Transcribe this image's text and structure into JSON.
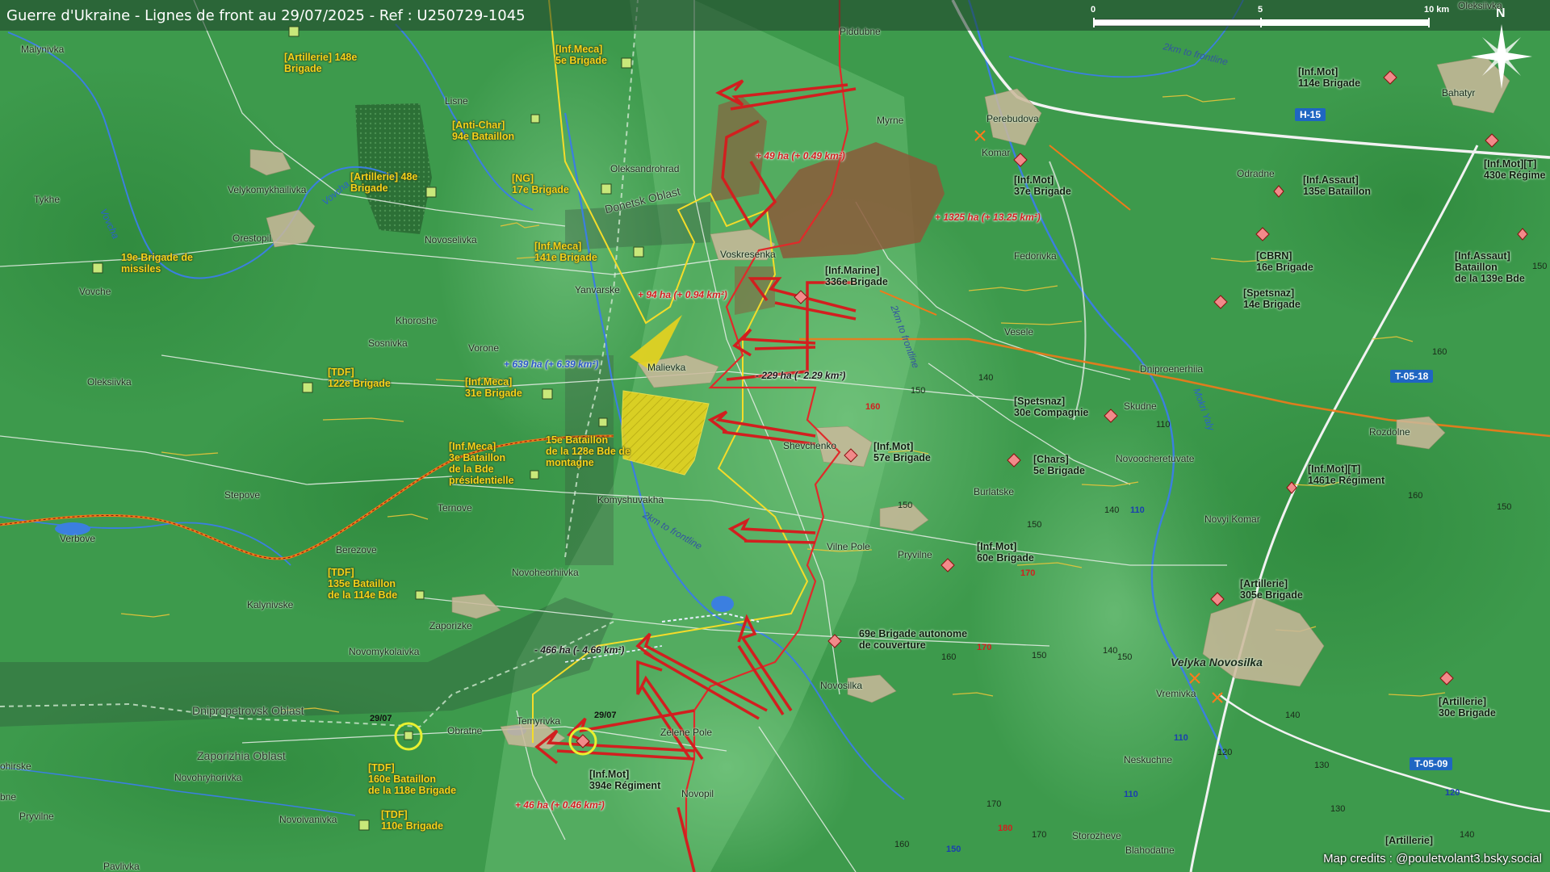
{
  "header": {
    "title": "Guerre d'Ukraine - Lignes de front au 29/07/2025 - Ref : U250729-1045"
  },
  "scale": {
    "zero": "0",
    "mid": "5",
    "end": "10 km"
  },
  "compass": {
    "north": "N"
  },
  "credits": "Map credits : @pouletvolant3.bsky.social",
  "colors": {
    "background_green": "#3d9a4c",
    "russian_arrow": "#d21f1f",
    "ukrainian_gain": "#e8d31e",
    "russian_gain_zone": "#8b5a3a",
    "road_badge": "#1f66c2"
  },
  "places": {
    "malynivka": "Malynivka",
    "lisne": "Lisne",
    "piddubne": "Piddubne",
    "myrne": "Myrne",
    "perebudova": "Perebudova",
    "komar": "Komar",
    "odradne": "Odradne",
    "bahatyr": "Bahatyr",
    "oleksiivka_ne": "Oleksiivka",
    "velykomykhailivka": "Velykomykhailivka",
    "tykhe": "Tykhe",
    "orestopil": "Orestopil",
    "vovche": "Vovche",
    "novoselivka": "Novoselivka",
    "oleksandrohrad": "Oleksandrohrad",
    "voskresenka": "Voskresenka",
    "fedorivka": "Fedorivka",
    "yanvarske": "Yanvarske",
    "khoroshe": "Khoroshe",
    "sosnivka": "Sosnivka",
    "vorone": "Vorone",
    "malievka": "Malievka",
    "vesele": "Vesele",
    "dniproenerhiia": "Dniproenerhiia",
    "oleksiivka_w": "Oleksiivka",
    "skudne": "Skudne",
    "rozdolne": "Rozdolne",
    "shevchenko": "Shevchenko",
    "novoocheretuvate": "Novoocheretuvate",
    "burlatske": "Burlatske",
    "stepove": "Stepove",
    "ternove": "Ternove",
    "komyshuvakha": "Komyshuvakha",
    "novyi_komar": "Novyi Komar",
    "verbove": "Verbove",
    "berezove": "Berezove",
    "vilne_pole": "Vilne Pole",
    "pryvilne": "Pryvilne",
    "novoheorhiivka": "Novoheorhiivka",
    "kalynivske": "Kalynivske",
    "zaporizke": "Zaporizke",
    "novomykolaivka": "Novomykolaivka",
    "novosilka": "Novosilka",
    "velyka_novosilka": "Velyka Novosilka",
    "vremivka": "Vremivka",
    "temyrivka": "Temyrivka",
    "obratne": "Obratne",
    "zelene_pole": "Zelene Pole",
    "ohirske": "ohirske",
    "novohryhorivka": "Novohryhorivka",
    "neskuchne": "Neskuchne",
    "bne": "bne",
    "pryvilne_sw": "Pryvilne",
    "novopil": "Novopil",
    "novoivanivka": "Novoivanivka",
    "storozheve": "Storozheve",
    "blahodatne": "Blahodatne",
    "pavlivka": "Pavlivka"
  },
  "oblasts": {
    "donetsk": "Donetsk Oblast",
    "dnipropetrovsk": "Dnipropetrovsk Oblast",
    "zaporizhia": "Zaporizhia Oblast"
  },
  "rivers": {
    "vovcha": "Vovcha",
    "vovcha2": "Vovcha",
    "mokri_yaly": "Mokri Yaly"
  },
  "to_frontline": [
    "2km to frontline",
    "2km to frontline",
    "2km to frontline",
    "2km to frontline"
  ],
  "roads": {
    "h15": "H-15",
    "t0518": "T-05-18",
    "t0509": "T-05-09"
  },
  "gains": {
    "g49": "+ 49 ha (+ 0.49 km²)",
    "g1325": "+ 1325 ha (+ 13.25 km²)",
    "g94": "+ 94 ha (+ 0.94 km²)",
    "g639": "+ 639 ha (+ 6.39 km²)",
    "l229": "- 229 ha (- 2.29 km²)",
    "l466": "- 466 ha (- 4.66 km²)",
    "g46": "+ 46 ha (+ 0.46 km²)"
  },
  "dates": {
    "d1": "29/07",
    "d2": "29/07"
  },
  "elevations": {
    "e140a": "140",
    "e150a": "150",
    "e110a": "110",
    "e160a": "160",
    "e150b": "150",
    "e160b": "160",
    "e150c": "150",
    "e140b": "140",
    "e150d": "150",
    "e160c": "160",
    "e150e": "150",
    "e140c": "140",
    "e130a": "130",
    "e140d": "140",
    "e120a": "120",
    "e130b": "130",
    "e140e": "140",
    "e150f": "150",
    "e160d": "160",
    "e170a": "170",
    "e160e": "160",
    "e170b": "170",
    "e150g": "150",
    "r160": "160",
    "r170a": "170",
    "r170b": "170",
    "r180": "180",
    "b110a": "110",
    "b110b": "110",
    "b110c": "110",
    "b120": "120",
    "b150": "150"
  },
  "units_ua": {
    "u148": "[Artillerie] 148e\nBrigade",
    "u5meca": "[Inf.Meca]\n5e Brigade",
    "u94": "[Anti-Char]\n94e Bataillon",
    "u48": "[Artillerie] 48e\nBrigade",
    "u17": "[NG]\n17e Brigade",
    "u19": "19e Brigade de\nmissiles",
    "u141": "[Inf.Meca]\n141e Brigade",
    "u122": "[TDF]\n122e Brigade",
    "u31": "[Inf.Meca]\n31e Brigade",
    "u3pres": "[Inf.Meca]\n3e Bataillon\nde la Bde\nprésidentielle",
    "u128": "15e Bataillon\nde la 128e Bde de\nmontagne",
    "u135": "[TDF]\n135e Bataillon\nde la 114e Bde",
    "u160": "[TDF]\n160e Bataillon\nde la 118e Brigade",
    "u110": "[TDF]\n110e Brigade"
  },
  "units_ru": {
    "r114": "[Inf.Mot]\n114e Brigade",
    "r430": "[Inf.Mot][T]\n430e Régime",
    "r37": "[Inf.Mot]\n37e Brigade",
    "r135a": "[Inf.Assaut]\n135e Bataillon",
    "r16": "[CBRN]\n16e Brigade",
    "r139": "[Inf.Assaut]\nBataillon\nde la 139e Bde",
    "r14": "[Spetsnaz]\n14e Brigade",
    "r336": "[Inf.Marine]\n336e Brigade",
    "r30sp": "[Spetsnaz]\n30e Compagnie",
    "r57": "[Inf.Mot]\n57e Brigade",
    "r5ch": "[Chars]\n5e Brigade",
    "r1461": "[Inf.Mot][T]\n1461e Régiment",
    "r60": "[Inf.Mot]\n60e Brigade",
    "r305": "[Artillerie]\n305e Brigade",
    "r69": "69e Brigade autonome\nde couverture",
    "r30art": "[Artillerie]\n30e Brigade",
    "r394": "[Inf.Mot]\n394e Régiment",
    "rart_se": "[Artillerie]"
  }
}
